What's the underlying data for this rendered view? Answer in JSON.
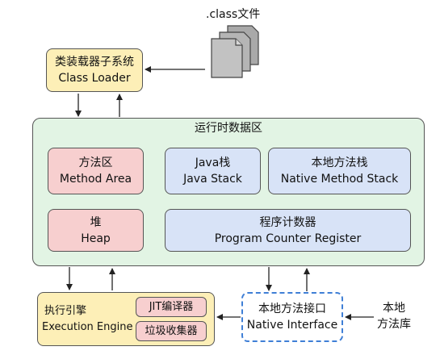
{
  "class_file": {
    "label": ".class文件"
  },
  "class_loader": {
    "line1": "类装载器子系统",
    "line2": "Class Loader"
  },
  "runtime_area": {
    "title": "运行时数据区",
    "method_area": {
      "line1": "方法区",
      "line2": "Method Area"
    },
    "java_stack": {
      "line1": "Java栈",
      "line2": "Java Stack"
    },
    "native_stack": {
      "line1": "本地方法栈",
      "line2": "Native Method Stack"
    },
    "heap": {
      "line1": "堆",
      "line2": "Heap"
    },
    "pc_register": {
      "line1": "程序计数器",
      "line2": "Program Counter Register"
    }
  },
  "execution_engine": {
    "line1": "执行引擎",
    "line2": "Execution Engine",
    "jit": "JIT编译器",
    "gc": "垃圾收集器"
  },
  "native_interface": {
    "line1": "本地方法接口",
    "line2": "Native Interface"
  },
  "native_library": {
    "line1": "本地",
    "line2": "方法库"
  },
  "colors": {
    "yellow": "#fdefb7",
    "green": "#e2f4e4",
    "red": "#f7cfcf",
    "blue": "#d8e3f7",
    "dashed_border": "#3f7fd6"
  }
}
